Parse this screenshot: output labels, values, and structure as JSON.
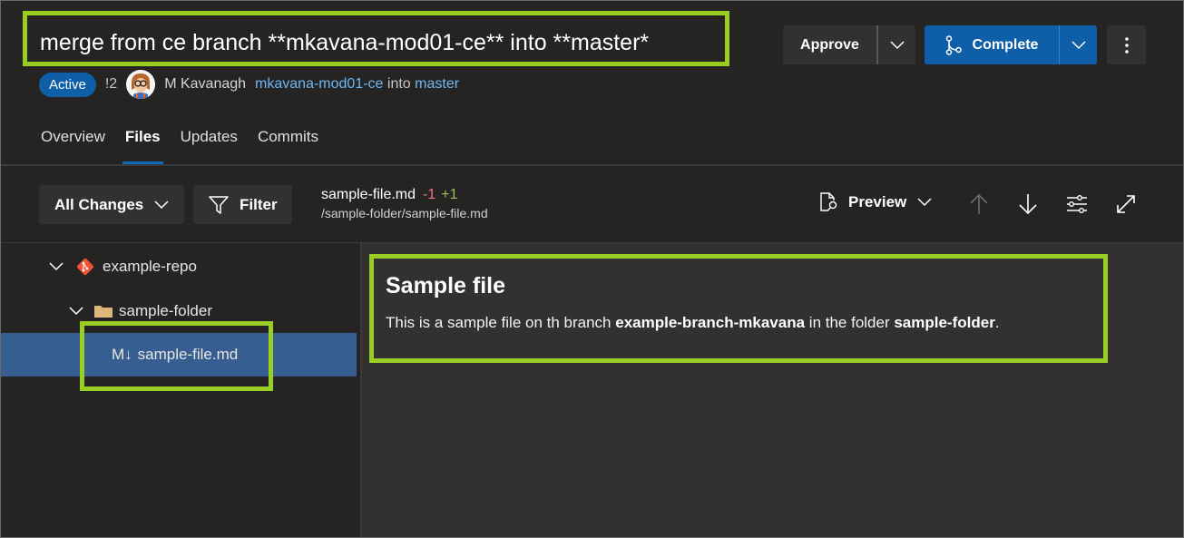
{
  "pull_request": {
    "title": "merge from ce branch **mkavana-mod01-ce** into **master*",
    "status": "Active",
    "id": "!2",
    "author": "M Kavanagh",
    "source_branch": "mkavana-mod01-ce",
    "into_label": "into",
    "target_branch": "master"
  },
  "actions": {
    "approve_label": "Approve",
    "complete_label": "Complete",
    "more_icon": "more-vertical-icon"
  },
  "tabs": [
    {
      "label": "Overview",
      "active": false
    },
    {
      "label": "Files",
      "active": true
    },
    {
      "label": "Updates",
      "active": false
    },
    {
      "label": "Commits",
      "active": false
    }
  ],
  "toolbar": {
    "changes_filter_label": "All Changes",
    "filter_label": "Filter",
    "preview_label": "Preview",
    "icons": [
      "chevron-up-icon",
      "chevron-down-icon",
      "settings-sliders-icon",
      "expand-icon"
    ]
  },
  "current_file": {
    "name": "sample-file.md",
    "deletions": "-1",
    "additions": "+1",
    "path": "/sample-folder/sample-file.md"
  },
  "file_tree": [
    {
      "label": "example-repo",
      "type": "repo",
      "expanded": true,
      "level": 0
    },
    {
      "label": "sample-folder",
      "type": "folder",
      "expanded": true,
      "level": 1
    },
    {
      "label": "sample-file.md",
      "type": "markdown-file",
      "selected": true,
      "level": 2,
      "icon_text": "M↓"
    }
  ],
  "preview": {
    "heading": "Sample file",
    "paragraph_prefix": "This is a sample file on th branch ",
    "bold_branch": "example-branch-mkavana",
    "paragraph_middle": " in the folder ",
    "bold_folder": "sample-folder",
    "paragraph_suffix": "."
  },
  "colors": {
    "accent": "#0f5ea8",
    "highlight_box": "#9acd22",
    "deletions": "#f1707b",
    "additions": "#92c353",
    "link": "#6cb8f6",
    "selected_row": "#365e91"
  }
}
